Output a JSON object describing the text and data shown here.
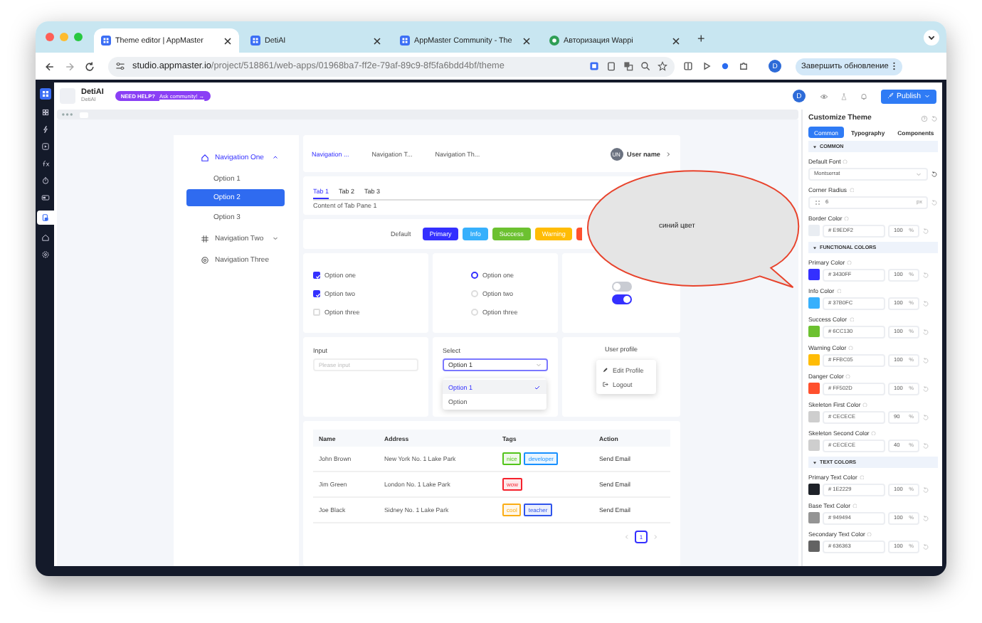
{
  "browser": {
    "tabs": [
      {
        "title": "Theme editor | AppMaster",
        "selected": true
      },
      {
        "title": "DetiAI",
        "selected": false
      },
      {
        "title": "AppMaster Community - The",
        "selected": false
      },
      {
        "title": "Авторизация Wappi",
        "selected": false
      }
    ],
    "new_tab": "+",
    "url": {
      "host": "studio.appmaster.io",
      "path": "/project/518861/web-apps/01968ba7-ff2e-79af-89c9-8f5fa6bdd4bf/theme"
    },
    "profile": "D",
    "update_button": "Завершить обновление"
  },
  "app": {
    "project_name": "DetiAI",
    "project_id": "DetiAI",
    "help_badge": "NEED HELP?",
    "help_link": "Ask community! →",
    "user_avatar": "D",
    "publish": "Publish"
  },
  "preview": {
    "sidebar": [
      {
        "label": "Navigation One",
        "expanded": true,
        "children": [
          {
            "label": "Option 1",
            "selected": false
          },
          {
            "label": "Option 2",
            "selected": true
          },
          {
            "label": "Option 3",
            "selected": false
          }
        ]
      },
      {
        "label": "Navigation Two",
        "expanded": false
      },
      {
        "label": "Navigation Three"
      }
    ],
    "header_nav": [
      {
        "label": "Navigation ...",
        "selected": true
      },
      {
        "label": "Navigation T...",
        "selected": false
      },
      {
        "label": "Navigation Th...",
        "selected": false
      }
    ],
    "user": {
      "avatar": "UN",
      "name": "User name"
    },
    "tabs": [
      {
        "label": "Tab 1",
        "selected": true
      },
      {
        "label": "Tab 2",
        "selected": false
      },
      {
        "label": "Tab 3",
        "selected": false
      }
    ],
    "tab_content": "Content of Tab Pane 1",
    "buttons": [
      {
        "kind": "default",
        "label": "Default"
      },
      {
        "kind": "primary",
        "label": "Primary"
      },
      {
        "kind": "info",
        "label": "Info"
      },
      {
        "kind": "success",
        "label": "Success"
      },
      {
        "kind": "warning",
        "label": "Warning"
      },
      {
        "kind": "danger"
      }
    ],
    "checkboxes": [
      {
        "label": "Option one",
        "checked": true
      },
      {
        "label": "Option two",
        "checked": true
      },
      {
        "label": "Option three",
        "checked": false
      }
    ],
    "radios": [
      {
        "label": "Option one",
        "selected": true
      },
      {
        "label": "Option two",
        "selected": false
      },
      {
        "label": "Option three",
        "selected": false
      }
    ],
    "switches": [
      {
        "on": false
      },
      {
        "on": true
      }
    ],
    "input": {
      "label": "Input",
      "placeholder": "Please input"
    },
    "select": {
      "label": "Select",
      "value": "Option 1",
      "options": [
        {
          "label": "Option 1",
          "selected": true
        },
        {
          "label": "Option",
          "selected": false
        }
      ]
    },
    "profile": {
      "title": "User profile",
      "menu": [
        {
          "label": "Edit Profile"
        },
        {
          "label": "Logout"
        }
      ]
    },
    "table": {
      "columns": [
        "Name",
        "Address",
        "Tags",
        "Action"
      ],
      "rows": [
        {
          "name": "John Brown",
          "address": "New York No. 1 Lake Park",
          "tags": [
            {
              "label": "nice",
              "color": "#52c41a"
            },
            {
              "label": "developer",
              "color": "#1890ff"
            }
          ],
          "action": "Send Email"
        },
        {
          "name": "Jim Green",
          "address": "London No. 1 Lake Park",
          "tags": [
            {
              "label": "wow",
              "color": "#f5222d"
            }
          ],
          "action": "Send Email"
        },
        {
          "name": "Joe Black",
          "address": "Sidney No. 1 Lake Park",
          "tags": [
            {
              "label": "cool",
              "color": "#faad14"
            },
            {
              "label": "teacher",
              "color": "#2f54eb"
            }
          ],
          "action": "Send Email"
        }
      ],
      "pages": [
        {
          "label": "1",
          "selected": true
        }
      ]
    }
  },
  "annotation": {
    "text": "синий цвет"
  },
  "theme_panel": {
    "title": "Customize Theme",
    "tabs": [
      {
        "label": "Common",
        "selected": true
      },
      {
        "label": "Typography",
        "selected": false
      },
      {
        "label": "Components",
        "selected": false
      }
    ],
    "sections": [
      {
        "title": "COMMON",
        "fields": [
          {
            "kind": "select",
            "label": "Default Font",
            "value": "Montserrat"
          },
          {
            "kind": "number",
            "label": "Corner Radius",
            "value": "6",
            "unit": "px"
          },
          {
            "kind": "color",
            "label": "Border Color",
            "color": "#e9edf2",
            "hex": "# E9EDF2",
            "opacity": "100",
            "unit": "%"
          }
        ]
      },
      {
        "title": "FUNCTIONAL COLORS",
        "fields": [
          {
            "kind": "color",
            "label": "Primary Color",
            "color": "#3430ff",
            "hex": "# 3430FF",
            "opacity": "100",
            "unit": "%"
          },
          {
            "kind": "color",
            "label": "Info Color",
            "color": "#37b0fc",
            "hex": "# 37B0FC",
            "opacity": "100",
            "unit": "%"
          },
          {
            "kind": "color",
            "label": "Success Color",
            "color": "#6cc130",
            "hex": "# 6CC130",
            "opacity": "100",
            "unit": "%"
          },
          {
            "kind": "color",
            "label": "Warning Color",
            "color": "#ffbc05",
            "hex": "# FFBC05",
            "opacity": "100",
            "unit": "%"
          },
          {
            "kind": "color",
            "label": "Danger Color",
            "color": "#ff502d",
            "hex": "# FF502D",
            "opacity": "100",
            "unit": "%"
          },
          {
            "kind": "color",
            "label": "Skeleton First Color",
            "color": "#cecece",
            "hex": "# CECECE",
            "opacity": "90",
            "unit": "%"
          },
          {
            "kind": "color",
            "label": "Skeleton Second Color",
            "color": "#cecece",
            "hex": "# CECECE",
            "opacity": "40",
            "unit": "%"
          }
        ]
      },
      {
        "title": "TEXT COLORS",
        "fields": [
          {
            "kind": "color",
            "label": "Primary Text Color",
            "color": "#1e2229",
            "hex": "# 1E2229",
            "opacity": "100",
            "unit": "%"
          },
          {
            "kind": "color",
            "label": "Base Text Color",
            "color": "#949494",
            "hex": "# 949494",
            "opacity": "100",
            "unit": "%"
          },
          {
            "kind": "color",
            "label": "Secondary Text Color",
            "color": "#636363",
            "hex": "# 636363",
            "opacity": "100",
            "unit": "%"
          }
        ]
      }
    ]
  }
}
